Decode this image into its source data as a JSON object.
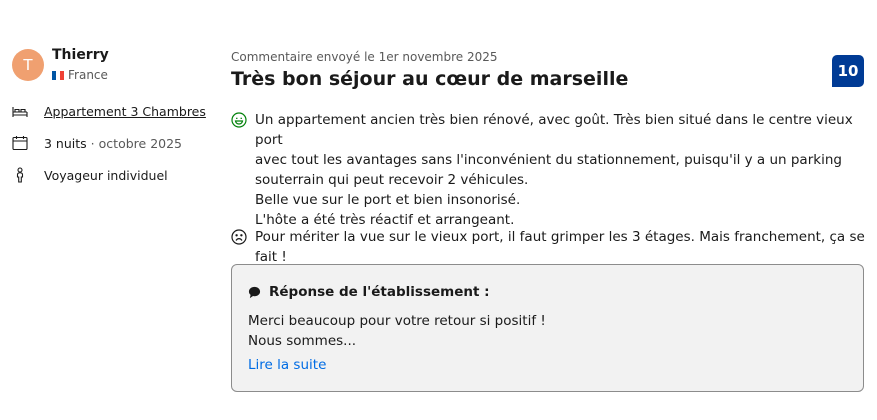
{
  "reviewer": {
    "initial": "T",
    "name": "Thierry",
    "country": "France"
  },
  "stay": {
    "room": "Appartement 3 Chambres",
    "nights": "3 nuits",
    "separator": "·",
    "month": "octobre 2025",
    "traveler_type": "Voyageur individuel"
  },
  "review": {
    "sent_date": "Commentaire envoyé le 1er novembre 2025",
    "title": "Très bon séjour au cœur de marseille",
    "score": "10",
    "positive_lines": [
      "Un appartement ancien très bien rénové, avec goût. Très bien situé dans le centre vieux port",
      "avec tout les avantages sans l'inconvénient du stationnement, puisqu'il y a un parking",
      "souterrain qui peut recevoir 2 véhicules.",
      "Belle vue sur le port et bien insonorisé.",
      "L'hôte a été très réactif et arrangeant."
    ],
    "negative": "Pour mériter la vue sur le vieux port, il faut grimper les 3 étages. Mais franchement, ça se fait !"
  },
  "response": {
    "header": "Réponse de l'établissement :",
    "lines": [
      "Merci beaucoup pour votre retour si positif !",
      "Nous sommes..."
    ],
    "read_more": "Lire la suite"
  },
  "icons": {
    "bed": "bed-icon",
    "calendar": "calendar-icon",
    "person": "person-icon",
    "happy": "smiley-happy-icon",
    "sad": "smiley-sad-icon",
    "speech": "speech-bubble-icon"
  },
  "colors": {
    "score_bg": "#003b95",
    "positive": "#008009",
    "link": "#006ce4",
    "avatar": "#f0a070"
  }
}
